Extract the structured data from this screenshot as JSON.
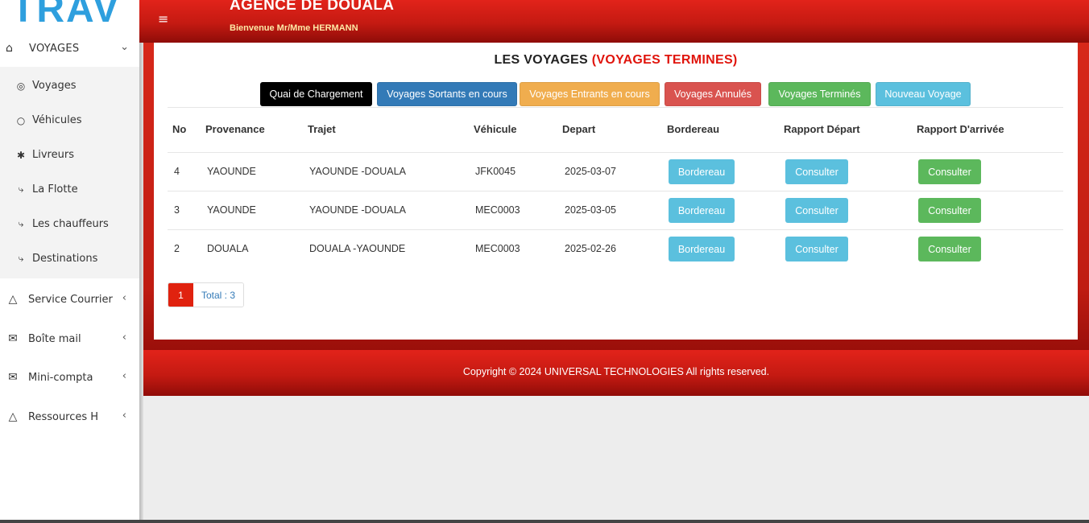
{
  "logo_text": "TRAV",
  "header": {
    "agency_title": "AGENCE DE DOUALA",
    "welcome": "Bienvenue Mr/Mme HERMANN"
  },
  "sidebar": {
    "top_menu": {
      "label": "VOYAGES",
      "icon": "home-icon"
    },
    "submenu": [
      {
        "label": "Voyages",
        "icon": "target-icon"
      },
      {
        "label": "Véhicules",
        "icon": "circle-icon"
      },
      {
        "label": "Livreurs",
        "icon": "person-icon"
      },
      {
        "label": "La Flotte",
        "icon": "bolt-icon"
      },
      {
        "label": "Les chauffeurs",
        "icon": "bolt-icon"
      },
      {
        "label": "Destinations",
        "icon": "bolt-icon"
      }
    ],
    "menus": [
      {
        "label": "Service Courrier",
        "icon": "flask-icon"
      },
      {
        "label": "Boîte mail",
        "icon": "envelope-icon"
      },
      {
        "label": "Mini-compta",
        "icon": "envelope-icon"
      },
      {
        "label": "Ressources H",
        "icon": "flask-icon"
      }
    ]
  },
  "page": {
    "title": "LES VOYAGES",
    "subtitle": "(VOYAGES TERMINES)"
  },
  "actions": [
    {
      "label": "Quai de Chargement",
      "color": "#000000"
    },
    {
      "label": "Voyages Sortants en cours",
      "color": "#337ab7"
    },
    {
      "label": "Voyages Entrants en cours",
      "color": "#f0ad4e"
    },
    {
      "label": "Voyages Annulés",
      "color": "#d9534f"
    },
    {
      "label": "Voyages Terminés",
      "color": "#5cb85c"
    },
    {
      "label": "Nouveau Voyage",
      "color": "#5bc0de"
    }
  ],
  "table": {
    "headers": [
      "No",
      "Provenance",
      "Trajet",
      "Véhicule",
      "Depart",
      "Bordereau",
      "Rapport Départ",
      "Rapport D'arrivée"
    ],
    "rows": [
      {
        "no": "4",
        "provenance": "YAOUNDE",
        "trajet": "YAOUNDE -DOUALA",
        "vehicule": "JFK0045",
        "depart": "2025-03-07",
        "bordereau": "Bordereau",
        "rapport_depart": "Consulter",
        "rapport_arrivee": "Consulter"
      },
      {
        "no": "3",
        "provenance": "YAOUNDE",
        "trajet": "YAOUNDE -DOUALA",
        "vehicule": "MEC0003",
        "depart": "2025-03-05",
        "bordereau": "Bordereau",
        "rapport_depart": "Consulter",
        "rapport_arrivee": "Consulter"
      },
      {
        "no": "2",
        "provenance": "DOUALA",
        "trajet": "DOUALA -YAOUNDE",
        "vehicule": "MEC0003",
        "depart": "2025-02-26",
        "bordereau": "Bordereau",
        "rapport_depart": "Consulter",
        "rapport_arrivee": "Consulter"
      }
    ]
  },
  "pagination": {
    "current": "1",
    "total": "Total : 3"
  },
  "footer": {
    "copyright": "Copyright © 2024 UNIVERSAL TECHNOLOGIES All rights reserved."
  }
}
